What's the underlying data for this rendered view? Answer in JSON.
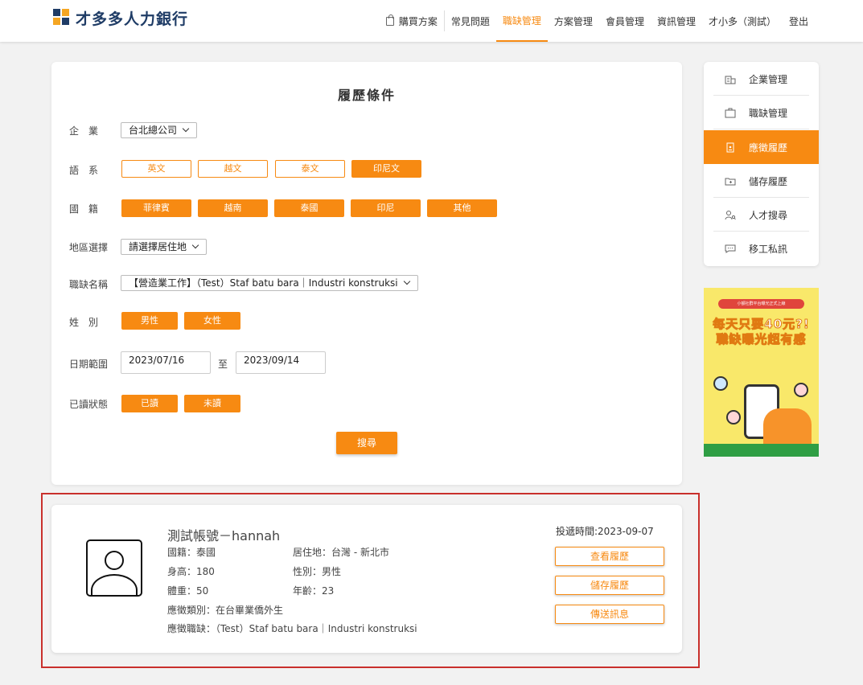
{
  "header": {
    "logo_text": "才多多人力銀行",
    "nav": {
      "buy": "購買方案",
      "faq": "常見問題",
      "jobs": "職缺管理",
      "plans": "方案管理",
      "members": "會員管理",
      "info": "資訊管理",
      "user": "才小多（測試）",
      "logout": "登出"
    }
  },
  "filter": {
    "title": "履歷條件",
    "company": {
      "label": "企　業",
      "value": "台北總公司"
    },
    "language": {
      "label": "語　系",
      "options": [
        "英文",
        "越文",
        "泰文",
        "印尼文"
      ]
    },
    "nationality": {
      "label": "國　籍",
      "options": [
        "菲律賓",
        "越南",
        "泰國",
        "印尼",
        "其他"
      ]
    },
    "region": {
      "label": "地區選擇",
      "value": "請選擇居住地"
    },
    "job": {
      "label": "職缺名稱",
      "value": "【營造業工作】（Test）Staf batu bara｜Industri konstruksi"
    },
    "gender": {
      "label": "姓　別",
      "options": [
        "男性",
        "女性"
      ]
    },
    "date": {
      "label": "日期範圍",
      "from": "2023/07/16",
      "to_label": "至",
      "to": "2023/09/14"
    },
    "read": {
      "label": "已讀狀態",
      "options": [
        "已讀",
        "未讀"
      ]
    },
    "search_label": "搜尋"
  },
  "sidebar": {
    "items": [
      {
        "label": "企業管理",
        "icon": "building-icon"
      },
      {
        "label": "職缺管理",
        "icon": "briefcase-icon"
      },
      {
        "label": "應徵履歷",
        "icon": "resume-icon"
      },
      {
        "label": "儲存履歷",
        "icon": "folder-icon"
      },
      {
        "label": "人才搜尋",
        "icon": "person-search-icon"
      },
      {
        "label": "移工私訊",
        "icon": "chat-icon"
      }
    ],
    "active_index": 2
  },
  "ad": {
    "top_line": "小額社群平台曝光正式上線",
    "line1": "每天只要40元?!",
    "line2": "職缺曝光超有感"
  },
  "result": {
    "name": "測試帳號－hannah",
    "nationality": "國籍：泰國",
    "residence": "居住地：台灣 - 新北市",
    "height": "身高：180",
    "gender": "性別：男性",
    "weight": "體重：50",
    "age": "年齡：23",
    "category": "應徵類別：在台畢業僑外生",
    "job": "應徵職缺：（Test）Staf batu bara｜Industri konstruksi",
    "time": "投遞時間:2023-09-07",
    "view_btn": "查看履歷",
    "save_btn": "儲存履歷",
    "msg_btn": "傳送訊息"
  },
  "colors": {
    "accent": "#f78a12",
    "brand": "#1f3c66",
    "highlight": "#c9302c"
  }
}
